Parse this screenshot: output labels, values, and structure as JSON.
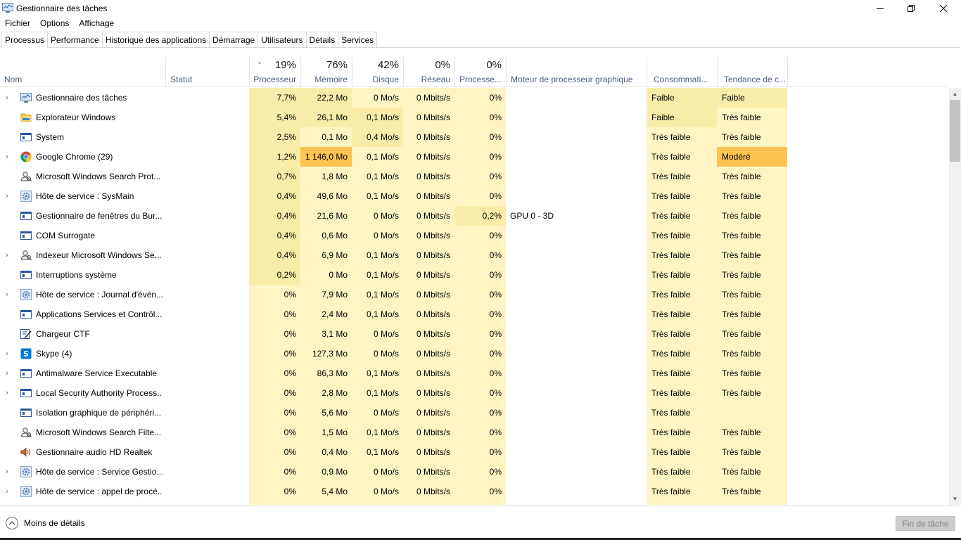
{
  "window": {
    "title": "Gestionnaire des tâches",
    "icon": "task-manager-icon"
  },
  "menu": [
    "Fichier",
    "Options",
    "Affichage"
  ],
  "tabs": [
    "Processus",
    "Performance",
    "Historique des applications",
    "Démarrage",
    "Utilisateurs",
    "Détails",
    "Services"
  ],
  "active_tab": "Processus",
  "columns": {
    "name": {
      "label": "Nom"
    },
    "status": {
      "label": "Statut"
    },
    "cpu": {
      "label": "Processeur",
      "percent": "19%"
    },
    "memory": {
      "label": "Mémoire",
      "percent": "76%"
    },
    "disk": {
      "label": "Disque",
      "percent": "42%"
    },
    "network": {
      "label": "Réseau",
      "percent": "0%"
    },
    "gpu": {
      "label": "Processe...",
      "percent": "0%"
    },
    "gpu_engine": {
      "label": "Moteur de processeur graphique"
    },
    "power": {
      "label": "Consommati..."
    },
    "power_trend": {
      "label": "Tendance de c..."
    }
  },
  "colors": {
    "heat_light": "#fff4c4",
    "heat_mid": "#f9eca8",
    "heat_strong": "#ffd36e",
    "heat_hot": "#ffc352",
    "header_text": "#4d6082"
  },
  "processes": [
    {
      "expand": true,
      "icon": "task-manager-icon",
      "name": "Gestionnaire des tâches",
      "cpu": "7,7%",
      "mem": "22,2 Mo",
      "disk": "0 Mo/s",
      "net": "0 Mbits/s",
      "gpu": "0%",
      "engine": "",
      "power": "Faible",
      "trend": "Faible",
      "h": [
        "m",
        "m",
        "l",
        "l",
        "l",
        "",
        "m",
        "m"
      ]
    },
    {
      "expand": false,
      "icon": "folder-icon",
      "name": "Explorateur Windows",
      "cpu": "5,4%",
      "mem": "26,1 Mo",
      "disk": "0,1 Mo/s",
      "net": "0 Mbits/s",
      "gpu": "0%",
      "engine": "",
      "power": "Faible",
      "trend": "Très faible",
      "h": [
        "m",
        "m",
        "m",
        "l",
        "l",
        "",
        "m",
        "l"
      ]
    },
    {
      "expand": false,
      "icon": "window-icon",
      "name": "System",
      "cpu": "2,5%",
      "mem": "0,1 Mo",
      "disk": "0,4 Mo/s",
      "net": "0 Mbits/s",
      "gpu": "0%",
      "engine": "",
      "power": "Très faible",
      "trend": "Très faible",
      "h": [
        "m",
        "l",
        "m",
        "l",
        "l",
        "",
        "l",
        "l"
      ]
    },
    {
      "expand": true,
      "icon": "chrome-icon",
      "name": "Google Chrome (29)",
      "cpu": "1,2%",
      "mem": "1 146,0 Mo",
      "disk": "0,1 Mo/s",
      "net": "0 Mbits/s",
      "gpu": "0%",
      "engine": "",
      "power": "Très faible",
      "trend": "Modéré",
      "h": [
        "m",
        "hot",
        "l",
        "l",
        "l",
        "",
        "l",
        "hot"
      ]
    },
    {
      "expand": false,
      "icon": "search-user-icon",
      "name": "Microsoft Windows Search Prot...",
      "cpu": "0,7%",
      "mem": "1,8 Mo",
      "disk": "0,1 Mo/s",
      "net": "0 Mbits/s",
      "gpu": "0%",
      "engine": "",
      "power": "Très faible",
      "trend": "Très faible",
      "h": [
        "m",
        "l",
        "l",
        "l",
        "l",
        "",
        "l",
        "l"
      ]
    },
    {
      "expand": true,
      "icon": "gear-icon",
      "name": "Hôte de service : SysMain",
      "cpu": "0,4%",
      "mem": "49,6 Mo",
      "disk": "0,1 Mo/s",
      "net": "0 Mbits/s",
      "gpu": "0%",
      "engine": "",
      "power": "Très faible",
      "trend": "Très faible",
      "h": [
        "m",
        "l",
        "l",
        "l",
        "l",
        "",
        "l",
        "l"
      ]
    },
    {
      "expand": false,
      "icon": "window-icon",
      "name": "Gestionnaire de fenêtres du Bur...",
      "cpu": "0,4%",
      "mem": "21,6 Mo",
      "disk": "0 Mo/s",
      "net": "0 Mbits/s",
      "gpu": "0,2%",
      "engine": "GPU 0 - 3D",
      "power": "Très faible",
      "trend": "Très faible",
      "h": [
        "m",
        "l",
        "l",
        "l",
        "m",
        "",
        "l",
        "l"
      ]
    },
    {
      "expand": false,
      "icon": "window-icon",
      "name": "COM Surrogate",
      "cpu": "0,4%",
      "mem": "0,6 Mo",
      "disk": "0 Mo/s",
      "net": "0 Mbits/s",
      "gpu": "0%",
      "engine": "",
      "power": "Très faible",
      "trend": "Très faible",
      "h": [
        "m",
        "l",
        "l",
        "l",
        "l",
        "",
        "l",
        "l"
      ]
    },
    {
      "expand": true,
      "icon": "search-user-icon",
      "name": "Indexeur Microsoft Windows Se...",
      "cpu": "0,4%",
      "mem": "6,9 Mo",
      "disk": "0,1 Mo/s",
      "net": "0 Mbits/s",
      "gpu": "0%",
      "engine": "",
      "power": "Très faible",
      "trend": "Très faible",
      "h": [
        "m",
        "l",
        "l",
        "l",
        "l",
        "",
        "l",
        "l"
      ]
    },
    {
      "expand": false,
      "icon": "window-icon",
      "name": "Interruptions système",
      "cpu": "0,2%",
      "mem": "0 Mo",
      "disk": "0,1 Mo/s",
      "net": "0 Mbits/s",
      "gpu": "0%",
      "engine": "",
      "power": "Très faible",
      "trend": "Très faible",
      "h": [
        "m",
        "l",
        "l",
        "l",
        "l",
        "",
        "l",
        "l"
      ]
    },
    {
      "expand": true,
      "icon": "gear-icon",
      "name": "Hôte de service : Journal d'évén...",
      "cpu": "0%",
      "mem": "7,9 Mo",
      "disk": "0,1 Mo/s",
      "net": "0 Mbits/s",
      "gpu": "0%",
      "engine": "",
      "power": "Très faible",
      "trend": "Très faible",
      "h": [
        "l",
        "l",
        "l",
        "l",
        "l",
        "",
        "l",
        "l"
      ]
    },
    {
      "expand": false,
      "icon": "window-icon",
      "name": "Applications Services et Contrôl...",
      "cpu": "0%",
      "mem": "2,4 Mo",
      "disk": "0,1 Mo/s",
      "net": "0 Mbits/s",
      "gpu": "0%",
      "engine": "",
      "power": "Très faible",
      "trend": "Très faible",
      "h": [
        "l",
        "l",
        "l",
        "l",
        "l",
        "",
        "l",
        "l"
      ]
    },
    {
      "expand": false,
      "icon": "pen-icon",
      "name": "Chargeur CTF",
      "cpu": "0%",
      "mem": "3,1 Mo",
      "disk": "0 Mo/s",
      "net": "0 Mbits/s",
      "gpu": "0%",
      "engine": "",
      "power": "Très faible",
      "trend": "Très faible",
      "h": [
        "l",
        "l",
        "l",
        "l",
        "l",
        "",
        "l",
        "l"
      ]
    },
    {
      "expand": true,
      "icon": "skype-icon",
      "name": "Skype (4)",
      "cpu": "0%",
      "mem": "127,3 Mo",
      "disk": "0 Mo/s",
      "net": "0 Mbits/s",
      "gpu": "0%",
      "engine": "",
      "power": "Très faible",
      "trend": "Très faible",
      "h": [
        "l",
        "l",
        "l",
        "l",
        "l",
        "",
        "l",
        "l"
      ]
    },
    {
      "expand": true,
      "icon": "window-icon",
      "name": "Antimalware Service Executable",
      "cpu": "0%",
      "mem": "86,3 Mo",
      "disk": "0,1 Mo/s",
      "net": "0 Mbits/s",
      "gpu": "0%",
      "engine": "",
      "power": "Très faible",
      "trend": "Très faible",
      "h": [
        "l",
        "l",
        "l",
        "l",
        "l",
        "",
        "l",
        "l"
      ]
    },
    {
      "expand": true,
      "icon": "window-icon",
      "name": "Local Security Authority Process...",
      "cpu": "0%",
      "mem": "2,8 Mo",
      "disk": "0,1 Mo/s",
      "net": "0 Mbits/s",
      "gpu": "0%",
      "engine": "",
      "power": "Très faible",
      "trend": "Très faible",
      "h": [
        "l",
        "l",
        "l",
        "l",
        "l",
        "",
        "l",
        "l"
      ]
    },
    {
      "expand": false,
      "icon": "window-icon",
      "name": "Isolation graphique de périphéri...",
      "cpu": "0%",
      "mem": "5,6 Mo",
      "disk": "0 Mo/s",
      "net": "0 Mbits/s",
      "gpu": "0%",
      "engine": "",
      "power": "Très faible",
      "trend": "",
      "h": [
        "l",
        "l",
        "l",
        "l",
        "l",
        "",
        "l",
        "l"
      ]
    },
    {
      "expand": false,
      "icon": "search-user-icon",
      "name": "Microsoft Windows Search Filte...",
      "cpu": "0%",
      "mem": "1,5 Mo",
      "disk": "0,1 Mo/s",
      "net": "0 Mbits/s",
      "gpu": "0%",
      "engine": "",
      "power": "Très faible",
      "trend": "Très faible",
      "h": [
        "l",
        "l",
        "l",
        "l",
        "l",
        "",
        "l",
        "l"
      ]
    },
    {
      "expand": false,
      "icon": "speaker-icon",
      "name": "Gestionnaire audio HD Realtek",
      "cpu": "0%",
      "mem": "0,4 Mo",
      "disk": "0,1 Mo/s",
      "net": "0 Mbits/s",
      "gpu": "0%",
      "engine": "",
      "power": "Très faible",
      "trend": "Très faible",
      "h": [
        "l",
        "l",
        "l",
        "l",
        "l",
        "",
        "l",
        "l"
      ]
    },
    {
      "expand": true,
      "icon": "gear-icon",
      "name": "Hôte de service : Service Gestio...",
      "cpu": "0%",
      "mem": "0,9 Mo",
      "disk": "0 Mo/s",
      "net": "0 Mbits/s",
      "gpu": "0%",
      "engine": "",
      "power": "Très faible",
      "trend": "Très faible",
      "h": [
        "l",
        "l",
        "l",
        "l",
        "l",
        "",
        "l",
        "l"
      ]
    },
    {
      "expand": true,
      "icon": "gear-icon",
      "name": "Hôte de service : appel de procé...",
      "cpu": "0%",
      "mem": "5,4 Mo",
      "disk": "0 Mo/s",
      "net": "0 Mbits/s",
      "gpu": "0%",
      "engine": "",
      "power": "Très faible",
      "trend": "Très faible",
      "h": [
        "l",
        "l",
        "l",
        "l",
        "l",
        "",
        "l",
        "l"
      ]
    }
  ],
  "footer": {
    "less_details": "Moins de détails",
    "end_task": "Fin de tâche"
  }
}
